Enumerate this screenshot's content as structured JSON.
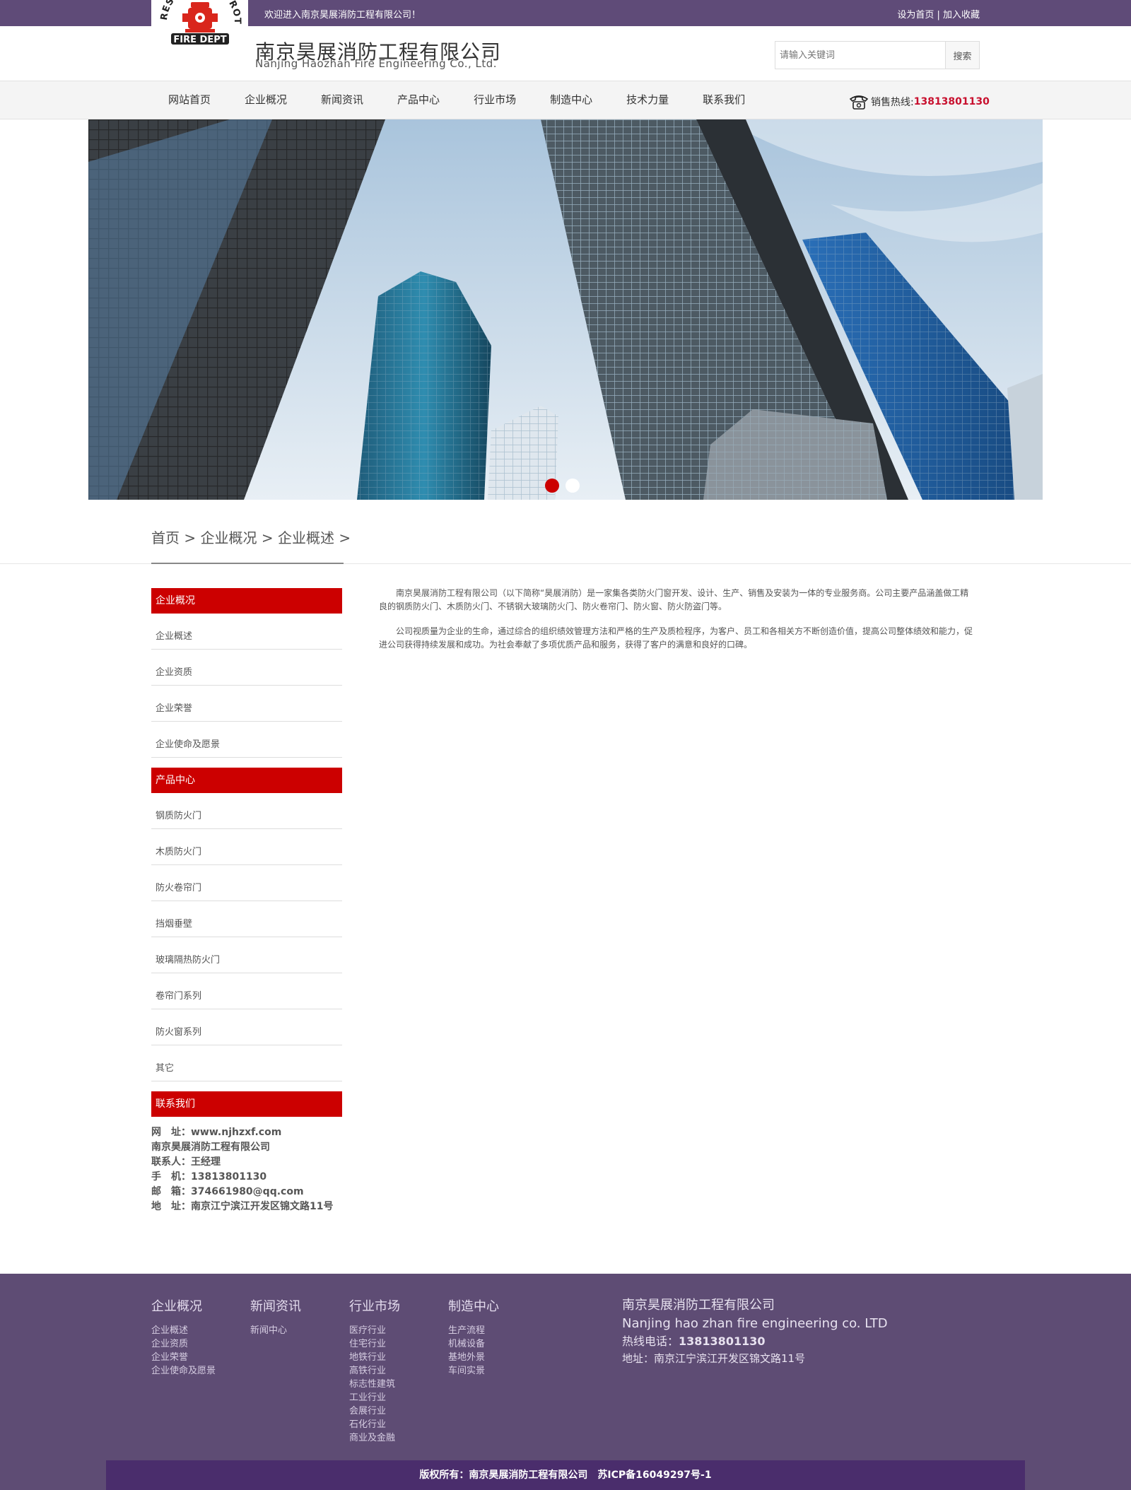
{
  "topbar": {
    "welcome": "欢迎进入南京昊展消防工程有限公司！",
    "set_home": "设为首页",
    "separator": " | ",
    "add_favorite": "加入收藏"
  },
  "logo": {
    "arc_text": "RESCUE AND PROTECTION",
    "badge_text": "FIRE DEPT",
    "icon": "fire-hydrant-icon"
  },
  "header": {
    "company_cn": "南京昊展消防工程有限公司",
    "company_en": "Nanjing Haozhan Fire Engineering Co., Ltd."
  },
  "search": {
    "placeholder": "请输入关键词",
    "button": "搜索"
  },
  "nav": {
    "items": [
      "网站首页",
      "企业概况",
      "新闻资讯",
      "产品中心",
      "行业市场",
      "制造中心",
      "技术力量",
      "联系我们"
    ],
    "hotline_label": "销售热线:",
    "hotline_number": "13813801130",
    "hotline_icon": "telephone-icon"
  },
  "banner": {
    "slides": 2,
    "active_slide": 1
  },
  "breadcrumb": {
    "home": "首页",
    "sep": " > ",
    "level1": "企业概况",
    "level2": "企业概述",
    "trail": " >"
  },
  "sidebar": {
    "section1_title": "企业概况",
    "section1_items": [
      "企业概述",
      "企业资质",
      "企业荣誉",
      "企业使命及愿景"
    ],
    "section2_title": "产品中心",
    "section2_items": [
      "钢质防火门",
      "木质防火门",
      "防火卷帘门",
      "挡烟垂壁",
      "玻璃隔热防火门",
      "卷帘门系列",
      "防火窗系列",
      "其它"
    ],
    "section3_title": "联系我们",
    "contact_lines": [
      "网　址：www.njhzxf.com",
      "南京昊展消防工程有限公司",
      "联系人：王经理",
      "手　机：13813801130",
      "邮　箱：374661980@qq.com",
      "地　址：南京江宁滨江开发区锦文路11号"
    ]
  },
  "content": {
    "paragraphs": [
      "南京昊展消防工程有限公司（以下简称“昊展消防）是一家集各类防火门窗开发、设计、生产、销售及安装为一体的专业服务商。公司主要产品涵盖做工精良的钢质防火门、木质防火门、不锈钢大玻璃防火门、防火卷帘门、防火窗、防火防盗门等。",
      "公司视质量为企业的生命，通过综合的组织绩效管理方法和严格的生产及质检程序，为客户、员工和各相关方不断创造价值，提高公司整体绩效和能力，促进公司获得持续发展和成功。为社会奉献了多项优质产品和服务，获得了客户的满意和良好的口碑。"
    ]
  },
  "footer": {
    "col1_title": "企业概况",
    "col1_items": [
      "企业概述",
      "企业资质",
      "企业荣誉",
      "企业使命及愿景"
    ],
    "col2_title": "新闻资讯",
    "col2_items": [
      "新闻中心"
    ],
    "col3_title": "行业市场",
    "col3_items": [
      "医疗行业",
      "住宅行业",
      "地铁行业",
      "高铁行业",
      "标志性建筑",
      "工业行业",
      "会展行业",
      "石化行业",
      "商业及金融"
    ],
    "col4_title": "制造中心",
    "col4_items": [
      "生产流程",
      "机械设备",
      "基地外景",
      "车间实景"
    ],
    "info_cn": "南京昊展消防工程有限公司",
    "info_en": "Nanjing hao zhan fire engineering co. LTD",
    "info_phone_label": "热线电话：",
    "info_phone": "13813801130",
    "info_address": "地址：南京江宁滨江开发区锦文路11号",
    "copyright": "版权所有：南京昊展消防工程有限公司　苏ICP备16049297号-1"
  },
  "colors": {
    "purple": "#5f4b78",
    "red": "#cc0000",
    "footer_bar": "#4a2d6c"
  }
}
